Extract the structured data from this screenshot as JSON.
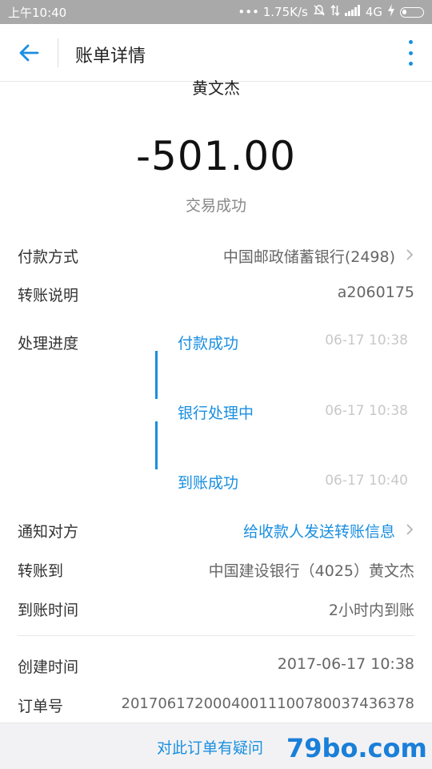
{
  "statusbar": {
    "time": "上午10:40",
    "network_speed": "••• 1.75K/s",
    "network_type": "4G"
  },
  "header": {
    "title": "账单详情"
  },
  "summary": {
    "payee_name": "黄文杰",
    "amount": "-501.00",
    "status": "交易成功"
  },
  "details": {
    "payment_method": {
      "label": "付款方式",
      "value": "中国邮政储蓄银行(2498)"
    },
    "transfer_note": {
      "label": "转账说明",
      "value": "a2060175"
    },
    "progress": {
      "label": "处理进度",
      "steps": [
        {
          "name": "付款成功",
          "time": "06-17 10:38"
        },
        {
          "name": "银行处理中",
          "time": "06-17 10:38"
        },
        {
          "name": "到账成功",
          "time": "06-17 10:40"
        }
      ]
    },
    "notify": {
      "label": "通知对方",
      "value": "给收款人发送转账信息"
    },
    "transfer_to": {
      "label": "转账到",
      "value": "中国建设银行（4025）黄文杰"
    },
    "arrival_time": {
      "label": "到账时间",
      "value": "2小时内到账"
    },
    "created_time": {
      "label": "创建时间",
      "value": "2017-06-17 10:38"
    },
    "order_no": {
      "label": "订单号",
      "value": "20170617200040011100780037436378"
    }
  },
  "footer": {
    "question_label": "对此订单有疑问",
    "watermark": "79bo.com"
  },
  "colors": {
    "accent": "#1a8fe0",
    "statusbar_bg": "#a9a9a9",
    "footer_bg": "#f2f2f4"
  }
}
